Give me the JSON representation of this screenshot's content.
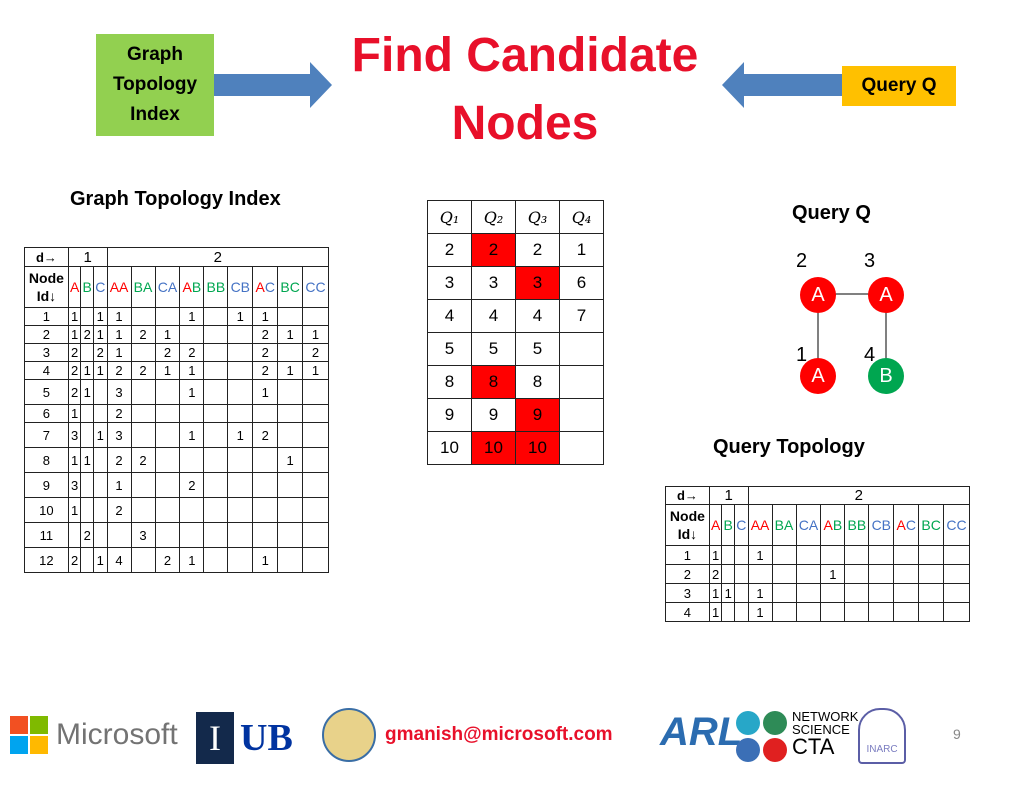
{
  "header": {
    "left_box": "Graph\nTopology\nIndex",
    "title": "Find Candidate\nNodes",
    "right_box": "Query  Q"
  },
  "gti": {
    "label": "Graph Topology Index",
    "d_label": "d→",
    "node_label": "Node Id↓",
    "d1": "1",
    "d2": "2",
    "cols": [
      [
        [
          "A",
          "ca"
        ]
      ],
      [
        [
          "B",
          "cb"
        ]
      ],
      [
        [
          "C",
          "cc"
        ]
      ],
      [
        [
          "AA",
          "ca"
        ]
      ],
      [
        [
          "BA",
          "cb"
        ]
      ],
      [
        [
          "CA",
          "cc"
        ]
      ],
      [
        [
          "A",
          "ca"
        ],
        [
          "B",
          "cb"
        ]
      ],
      [
        [
          "BB",
          "cb"
        ]
      ],
      [
        [
          "CB",
          "cc"
        ]
      ],
      [
        [
          "A",
          "ca"
        ],
        [
          "C",
          "cc"
        ]
      ],
      [
        [
          "BC",
          "cb"
        ]
      ],
      [
        [
          "CC",
          "cc"
        ]
      ]
    ],
    "rows": [
      [
        "1",
        "1",
        "",
        "1",
        "1",
        "",
        "",
        "1",
        "",
        "1",
        "1",
        "",
        ""
      ],
      [
        "2",
        "1",
        "2",
        "1",
        "1",
        "2",
        "1",
        "",
        "",
        "",
        "2",
        "1",
        "1"
      ],
      [
        "3",
        "2",
        "",
        "2",
        "1",
        "",
        "2",
        "2",
        "",
        "",
        "2",
        "",
        "2"
      ],
      [
        "4",
        "2",
        "1",
        "1",
        "2",
        "2",
        "1",
        "1",
        "",
        "",
        "2",
        "1",
        "1"
      ],
      [
        "5",
        "2",
        "1",
        "",
        "3",
        "",
        "",
        "1",
        "",
        "",
        "1",
        "",
        ""
      ],
      [
        "6",
        "1",
        "",
        "",
        "2",
        "",
        "",
        "",
        "",
        "",
        "",
        "",
        ""
      ],
      [
        "7",
        "3",
        "",
        "1",
        "3",
        "",
        "",
        "1",
        "",
        "1",
        "2",
        "",
        ""
      ],
      [
        "8",
        "1",
        "1",
        "",
        "2",
        "2",
        "",
        "",
        "",
        "",
        "",
        "1",
        ""
      ],
      [
        "9",
        "3",
        "",
        "",
        "1",
        "",
        "",
        "2",
        "",
        "",
        "",
        "",
        ""
      ],
      [
        "10",
        "1",
        "",
        "",
        "2",
        "",
        "",
        "",
        "",
        "",
        "",
        "",
        ""
      ],
      [
        "11",
        "",
        "2",
        "",
        "",
        "3",
        "",
        "",
        "",
        "",
        "",
        "",
        ""
      ],
      [
        "12",
        "2",
        "",
        "1",
        "4",
        "",
        "2",
        "1",
        "",
        "",
        "1",
        "",
        ""
      ]
    ]
  },
  "candidates": {
    "headers": [
      "Q₁",
      "Q₂",
      "Q₃",
      "Q₄"
    ],
    "rows": [
      [
        [
          "2",
          0
        ],
        [
          "2",
          1
        ],
        [
          "2",
          0
        ],
        [
          "1",
          0
        ]
      ],
      [
        [
          "3",
          0
        ],
        [
          "3",
          0
        ],
        [
          "3",
          1
        ],
        [
          "6",
          0
        ]
      ],
      [
        [
          "4",
          0
        ],
        [
          "4",
          0
        ],
        [
          "4",
          0
        ],
        [
          "7",
          0
        ]
      ],
      [
        [
          "5",
          0
        ],
        [
          "5",
          0
        ],
        [
          "5",
          0
        ],
        [
          "",
          0
        ]
      ],
      [
        [
          "8",
          0
        ],
        [
          "8",
          1
        ],
        [
          "8",
          0
        ],
        [
          "",
          0
        ]
      ],
      [
        [
          "9",
          0
        ],
        [
          "9",
          0
        ],
        [
          "9",
          1
        ],
        [
          "",
          0
        ]
      ],
      [
        [
          "10",
          0
        ],
        [
          "10",
          1
        ],
        [
          "10",
          1
        ],
        [
          "",
          0
        ]
      ]
    ]
  },
  "query": {
    "label": "Query Q",
    "nodes": [
      {
        "id": "2",
        "label": "A"
      },
      {
        "id": "3",
        "label": "A"
      },
      {
        "id": "1",
        "label": "A"
      },
      {
        "id": "4",
        "label": "B"
      }
    ],
    "topology_label": "Query Topology",
    "rows": [
      [
        "1",
        "1",
        "",
        "",
        "1",
        "",
        "",
        "",
        "",
        "",
        "",
        "",
        ""
      ],
      [
        "2",
        "2",
        "",
        "",
        "",
        "",
        "",
        "1",
        "",
        "",
        "",
        "",
        ""
      ],
      [
        "3",
        "1",
        "1",
        "",
        "1",
        "",
        "",
        "",
        "",
        "",
        "",
        "",
        ""
      ],
      [
        "4",
        "1",
        "",
        "",
        "1",
        "",
        "",
        "",
        "",
        "",
        "",
        "",
        ""
      ]
    ]
  },
  "footer": {
    "email": "gmanish@microsoft.com",
    "microsoft": "Microsoft",
    "page": "9",
    "ns1": "NETWORK",
    "ns2": "SCIENCE",
    "ns3": "CTA",
    "arl": "ARL",
    "inarc": "INARC"
  },
  "colors": {
    "red": "#ff0000",
    "green": "#00a650",
    "blue": "#4472c4"
  }
}
